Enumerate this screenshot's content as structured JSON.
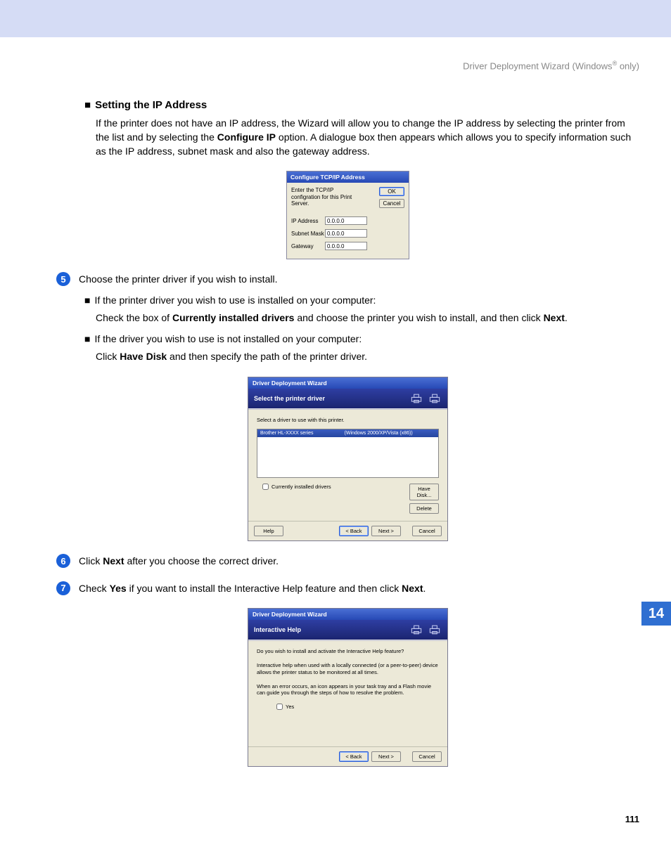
{
  "header": {
    "text_before": "Driver Deployment Wizard (Windows",
    "text_after": " only)"
  },
  "section_heading": "Setting the IP Address",
  "section_para_pre": "If the printer does not have an IP address, the Wizard will allow you to change the IP address by selecting the printer from the list and by selecting the ",
  "section_para_bold": "Configure IP",
  "section_para_post": " option. A dialogue box then appears which allows you to specify information such as the IP address, subnet mask and also the gateway address.",
  "tcpip": {
    "title": "Configure TCP/IP Address",
    "desc": "Enter the TCP/IP configration for this Print Server.",
    "ok": "OK",
    "cancel": "Cancel",
    "rows": {
      "ip_label": "IP Address",
      "ip_value": "0.0.0.0",
      "mask_label": "Subnet Mask",
      "mask_value": "0.0.0.0",
      "gw_label": "Gateway",
      "gw_value": "0.0.0.0"
    }
  },
  "step5": {
    "num": "5",
    "text": "Choose the printer driver if you wish to install."
  },
  "sub5a": "If the printer driver you wish to use is installed on your computer:",
  "sub5a_para_pre": "Check the box of ",
  "sub5a_para_b1": "Currently installed drivers",
  "sub5a_para_mid": " and choose the printer you wish to install, and then click ",
  "sub5a_para_b2": "Next",
  "sub5a_para_post": ".",
  "sub5b": "If the driver you wish to use is not installed on your computer:",
  "sub5b_para_pre": "Click ",
  "sub5b_para_b1": "Have Disk",
  "sub5b_para_post": " and then specify the path of the printer driver.",
  "wiz1": {
    "title": "Driver Deployment Wizard",
    "banner": "Select the printer driver",
    "instr": "Select a driver to use with this printer.",
    "col1": "Brother HL-XXXX series",
    "col2": "(Windows 2000/XP/Vista (x86))",
    "chk": "Currently installed drivers",
    "have_disk": "Have Disk...",
    "delete": "Delete",
    "help": "Help",
    "back": "< Back",
    "next": "Next >",
    "cancel": "Cancel"
  },
  "step6": {
    "num": "6",
    "pre": "Click ",
    "b": "Next",
    "post": " after you choose the correct driver."
  },
  "step7": {
    "num": "7",
    "pre": "Check ",
    "b1": "Yes",
    "mid": " if you want to install the Interactive Help feature and then click ",
    "b2": "Next",
    "post": "."
  },
  "wiz2": {
    "title": "Driver Deployment Wizard",
    "banner": "Interactive Help",
    "q": "Do you wish to install and activate the Interactive Help feature?",
    "p1": "Interactive help when used with a locally connected (or a peer-to-peer) device allows the printer status to be monitored at all times.",
    "p2": "When an error occurs, an icon appears in your task tray and a Flash movie can guide you through the steps of how to resolve the problem.",
    "yes": "Yes",
    "back": "< Back",
    "next": "Next >",
    "cancel": "Cancel"
  },
  "side_tab": "14",
  "page_number": "111"
}
